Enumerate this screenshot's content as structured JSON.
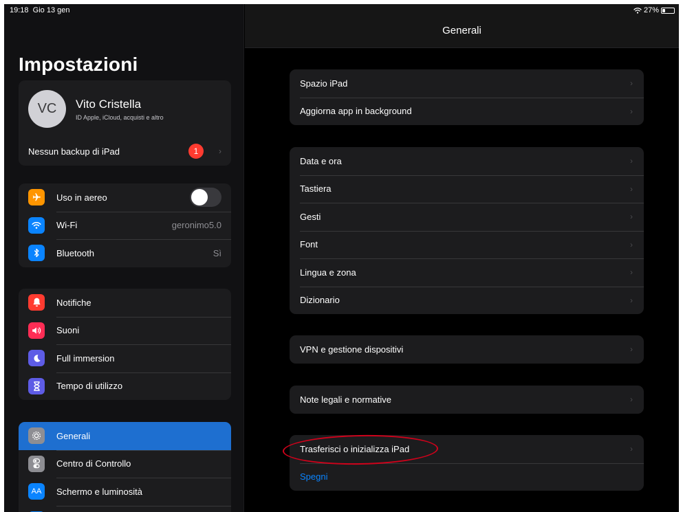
{
  "status_bar": {
    "time": "19:18",
    "date": "Gio 13 gen",
    "battery": "27%"
  },
  "sidebar": {
    "title": "Impostazioni",
    "profile": {
      "initials": "VC",
      "name": "Vito Cristella",
      "subtitle": "ID Apple, iCloud, acquisti e altro"
    },
    "backup": {
      "label": "Nessun backup di iPad",
      "badge": "1"
    },
    "connectivity": [
      {
        "label": "Uso in aereo",
        "icon": "airplane-icon",
        "color": "#ff9500"
      },
      {
        "label": "Wi-Fi",
        "value": "geronimo5.0",
        "icon": "wifi-icon",
        "color": "#0a84ff"
      },
      {
        "label": "Bluetooth",
        "value": "Sì",
        "icon": "bluetooth-icon",
        "color": "#0a84ff"
      }
    ],
    "notifications": [
      {
        "label": "Notifiche",
        "icon": "bell-icon",
        "color": "#ff3b30"
      },
      {
        "label": "Suoni",
        "icon": "speaker-icon",
        "color": "#ff2d55"
      },
      {
        "label": "Full immersion",
        "icon": "moon-icon",
        "color": "#5e5ce6"
      },
      {
        "label": "Tempo di utilizzo",
        "icon": "hourglass-icon",
        "color": "#5e5ce6"
      }
    ],
    "system": [
      {
        "label": "Generali",
        "icon": "gear-icon",
        "color": "#8e8e93"
      },
      {
        "label": "Centro di Controllo",
        "icon": "switches-icon",
        "color": "#8e8e93"
      },
      {
        "label": "Schermo e luminosità",
        "icon": "text-size-icon",
        "color": "#0a84ff"
      }
    ]
  },
  "main": {
    "title": "Generali",
    "group1": [
      "Spazio iPad",
      "Aggiorna app in background"
    ],
    "group2": [
      "Data e ora",
      "Tastiera",
      "Gesti",
      "Font",
      "Lingua e zona",
      "Dizionario"
    ],
    "group3": [
      "VPN e gestione dispositivi"
    ],
    "group4": [
      "Note legali e normative"
    ],
    "group5": {
      "transfer": "Trasferisci o inizializza iPad",
      "shutdown": "Spegni"
    }
  }
}
